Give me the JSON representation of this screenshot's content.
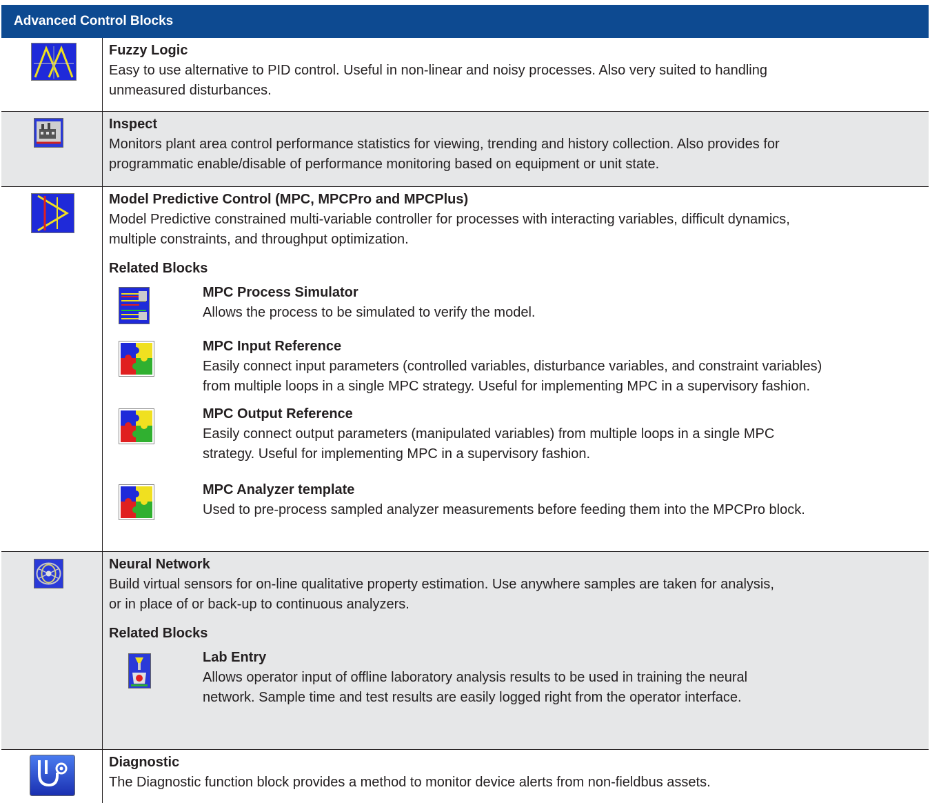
{
  "header": {
    "title": "Advanced Control Blocks"
  },
  "blocks": [
    {
      "title": "Fuzzy Logic",
      "icon": "fuzzy-logic-icon",
      "desc": [
        "Easy to use alternative to PID control. Useful in non-linear and noisy processes. Also very suited to handling",
        "unmeasured disturbances."
      ]
    },
    {
      "title": "Inspect",
      "icon": "inspect-icon",
      "desc": [
        "Monitors plant area control performance statistics for viewing, trending and history collection. Also provides for",
        "programmatic enable/disable of performance monitoring based on equipment or unit state."
      ]
    },
    {
      "title": "Model Predictive Control (MPC, MPCPro and MPCPlus)",
      "icon": "mpc-icon",
      "desc": [
        "Model Predictive constrained multi-variable controller for processes with interacting variables, difficult dynamics,",
        "multiple constraints, and throughput optimization."
      ],
      "related_label": "Related Blocks",
      "related": [
        {
          "title": "MPC Process Simulator",
          "icon": "mpc-simulator-icon",
          "desc": [
            "Allows the process to be simulated to verify the model."
          ]
        },
        {
          "title": "MPC Input Reference",
          "icon": "puzzle-icon",
          "desc": [
            "Easily connect input parameters (controlled variables, disturbance variables, and constraint  variables)",
            "from multiple loops in a single MPC strategy. Useful for implementing MPC in a  supervisory fashion."
          ]
        },
        {
          "title": "MPC Output Reference",
          "icon": "puzzle-icon",
          "desc": [
            "Easily connect output parameters (manipulated variables) from multiple loops in a single MPC",
            "strategy. Useful for implementing MPC in a supervisory fashion."
          ]
        },
        {
          "title": "MPC Analyzer template",
          "icon": "puzzle-icon",
          "desc": [
            "Used to pre-process sampled analyzer measurements before feeding them into the MPCPro block."
          ]
        }
      ]
    },
    {
      "title": "Neural Network",
      "icon": "neural-network-icon",
      "desc": [
        "Build virtual sensors for on-line qualitative property estimation. Use anywhere samples are taken for analysis,",
        "or in place of or back-up to continuous analyzers."
      ],
      "related_label": "Related Blocks",
      "related": [
        {
          "title": "Lab Entry",
          "icon": "lab-entry-icon",
          "desc": [
            "Allows operator input of offline laboratory analysis results to be used in training the neural",
            "network. Sample time and test results are easily logged right from the operator interface."
          ]
        }
      ]
    },
    {
      "title": "Diagnostic",
      "icon": "stethoscope-icon",
      "desc": [
        "The Diagnostic function block provides a method to monitor device alerts from non-fieldbus assets."
      ]
    }
  ]
}
